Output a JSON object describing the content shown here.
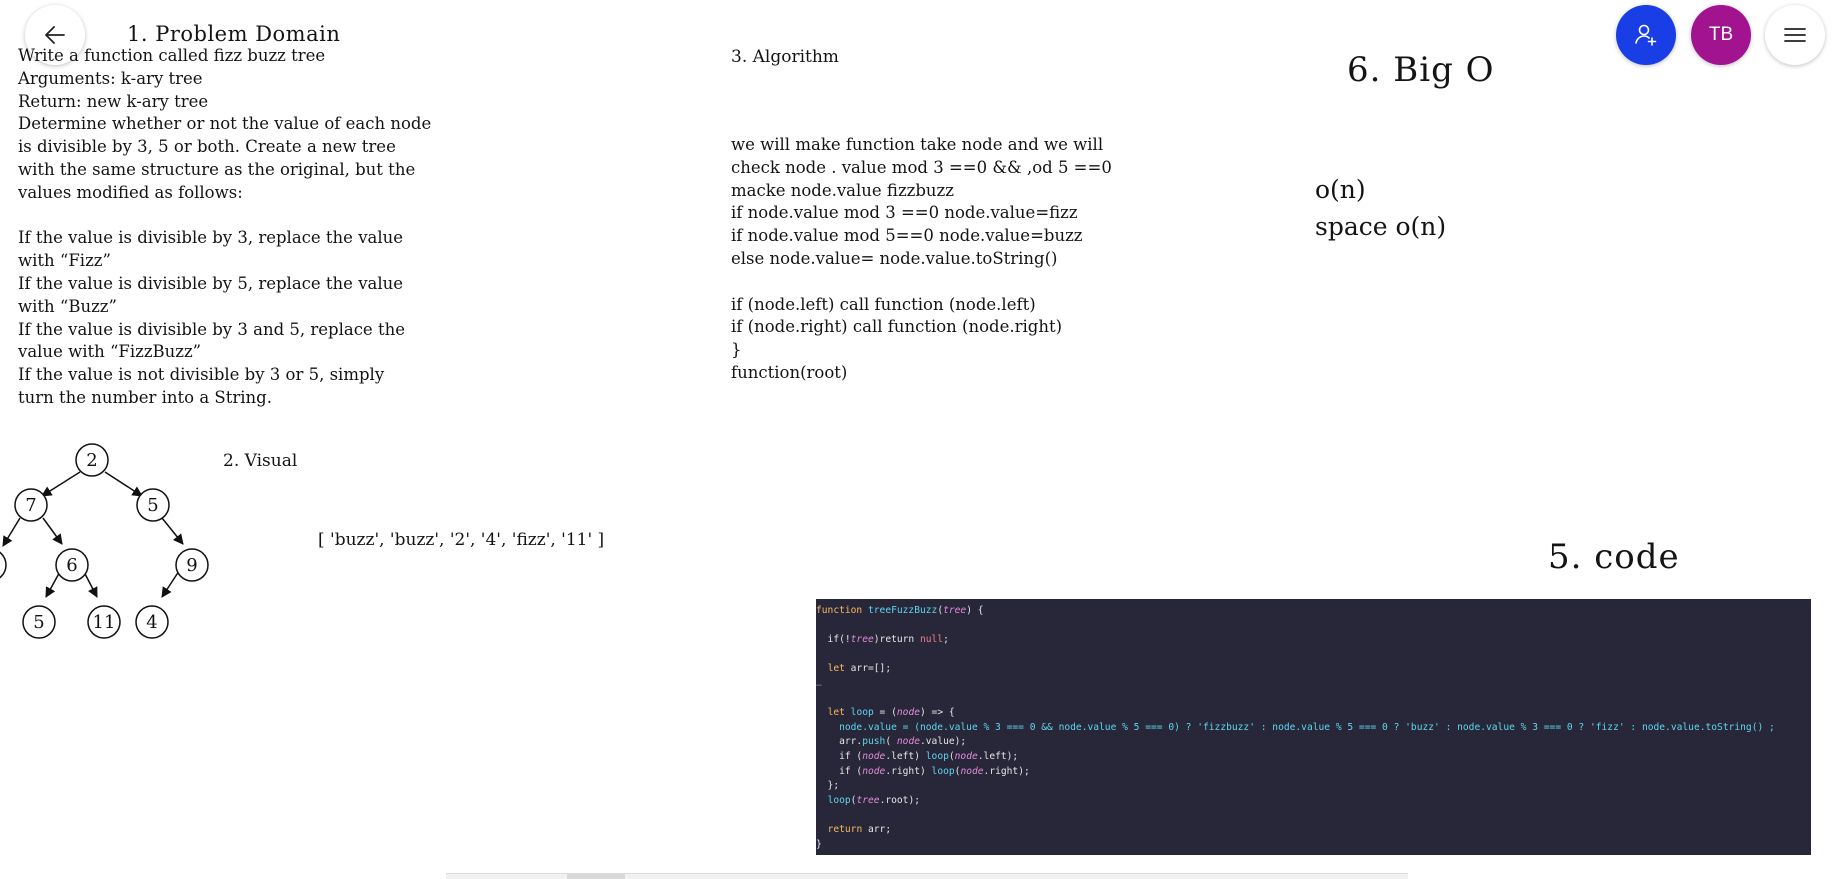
{
  "controls": {
    "avatar_initials": "TB",
    "accent_share": "#1a3ee6",
    "accent_avatar": "#a1138f",
    "back_icon": "arrow-left-icon",
    "share_icon": "add-person-icon",
    "menu_icon": "hamburger-menu-icon"
  },
  "sections": {
    "problem_domain": "1. Problem Domain",
    "visual": "2. Visual",
    "algorithm": "3. Algorithm",
    "code": "5. code",
    "big_o": "6. Big O"
  },
  "problem_lines": [
    "Write a function called fizz buzz tree",
    "Arguments: k-ary tree",
    "Return: new k-ary tree",
    "Determine whether or not the value of each node",
    "is divisible by 3, 5 or both. Create a new tree",
    "with the same structure as the original, but the",
    "values modified as follows:",
    "",
    "If the value is divisible by 3, replace the value",
    "with “Fizz”",
    "If the value is divisible by 5, replace the value",
    "with “Buzz”",
    "If the value is divisible by 3 and 5, replace the",
    "value with “FizzBuzz”",
    "If the value is not divisible by 3 or 5, simply",
    "turn the number into a String."
  ],
  "algorithm_lines": [
    "we will make function take node  and we will",
    "check node . value mod 3 ==0  && ,od 5 ==0",
    "macke node.value fizzbuzz",
    "if node.value mod 3 ==0    node.value=fizz",
    "if node.value mod 5==0     node.value=buzz",
    "else node.value= node.value.toString()",
    "",
    "if (node.left) call function (node.left)",
    "if (node.right) call function (node.right)",
    "}",
    "function(root)"
  ],
  "big_o_lines": [
    "o(n)",
    "space o(n)"
  ],
  "result_array": "[ 'buzz', 'buzz', '2', '4', 'fizz', '11' ]",
  "tree_nodes": {
    "root": "2",
    "left": "7",
    "right": "5",
    "left_left": "",
    "left_right": "6",
    "right_right": "9",
    "left_right_left": "5",
    "left_right_right": "11",
    "right_right_left": "4"
  },
  "code": {
    "line1": {
      "kw": "function",
      "name": "treeFuzzBuzz",
      "open": "(",
      "param": "tree",
      "close": ") {"
    },
    "line2": {
      "pre": "  if(!",
      "param": "tree",
      "mid": ")return ",
      "kw": "null",
      "end": ";"
    },
    "line3": {
      "pre": "  ",
      "kw": "let",
      "rest": " arr=[];"
    },
    "line4": {
      "ellipsis": "…"
    },
    "line5": {
      "pre": "  ",
      "kw": "let",
      "name": " loop",
      "mid": " = (",
      "param": "node",
      "end": ") => {"
    },
    "line6": "    node.value = (node.value % 3 === 0 && node.value % 5 === 0) ? 'fizzbuzz' : node.value % 5 === 0 ? 'buzz' : node.value % 3 === 0 ? 'fizz' : node.value.toString() ;",
    "line7": {
      "pre": "    arr.",
      "fn": "push",
      "mid": "( ",
      "param": "node",
      "end": ".value);"
    },
    "line8": {
      "pre": "    if (",
      "param": "node",
      "mid": ".left) ",
      "fn": "loop",
      "open": "(",
      "param2": "node",
      "end": ".left);"
    },
    "line9": {
      "pre": "    if (",
      "param": "node",
      "mid": ".right) ",
      "fn": "loop",
      "open": "(",
      "param2": "node",
      "end": ".right);"
    },
    "line10": "  };",
    "line11": {
      "pre": "  ",
      "fn": "loop",
      "open": "(",
      "param": "tree",
      "end": ".root);"
    },
    "line12": {
      "pre": "  ",
      "kw": "return",
      "rest": " arr;"
    },
    "line13": "}",
    "background": "#272739"
  }
}
